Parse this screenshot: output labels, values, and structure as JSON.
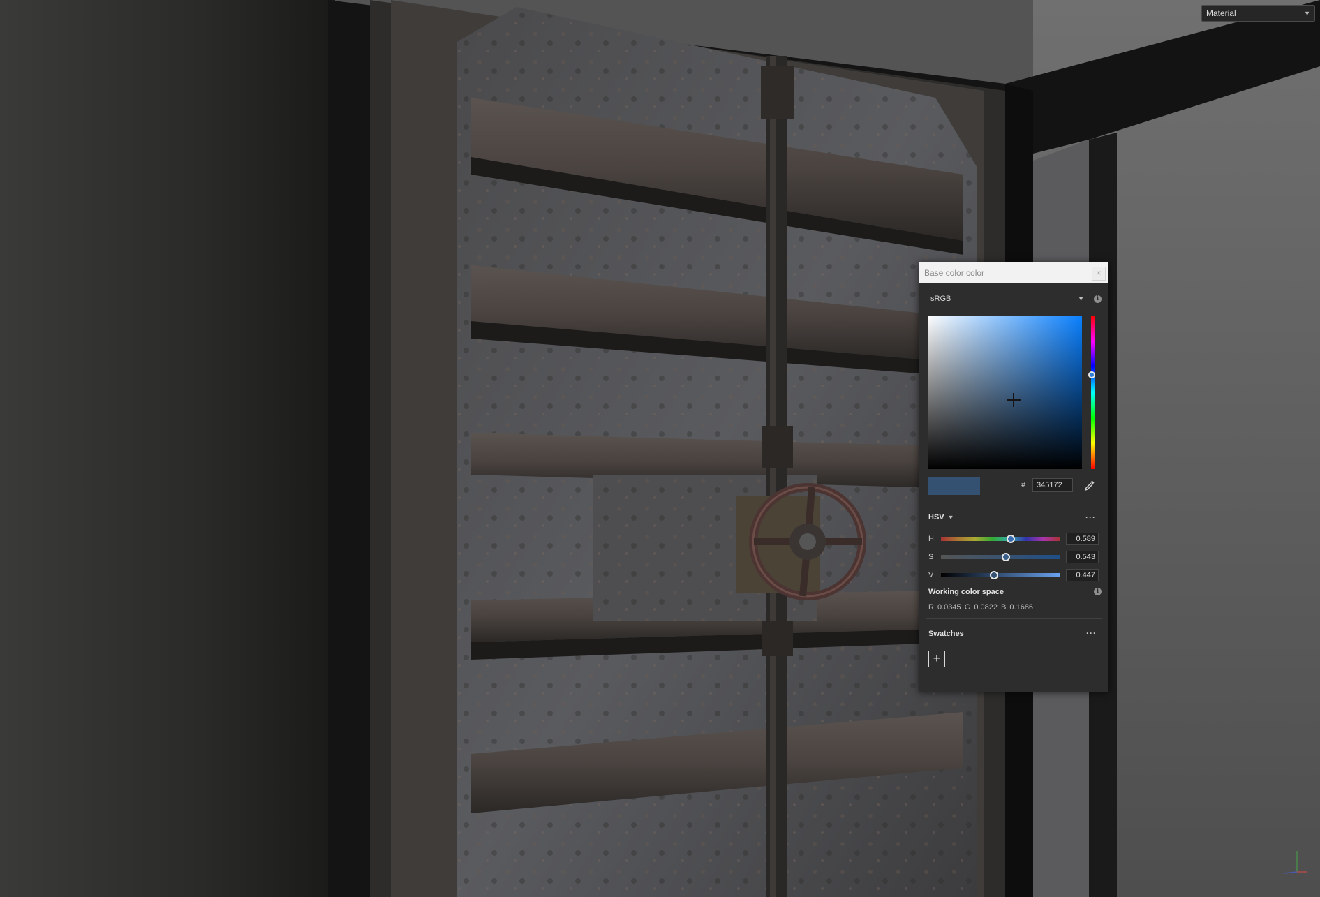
{
  "toolbar": {
    "material_select": {
      "value": "Material",
      "chevron_icon": "chevron-down-icon"
    }
  },
  "color_picker": {
    "title": "Base color color",
    "close_icon": "close-icon",
    "color_space": "sRGB",
    "info_icon": "info-icon",
    "current_color": "#345172",
    "hash_label": "#",
    "hex_value": "345172",
    "eyedropper_icon": "eyedropper-icon",
    "mode": "HSV",
    "more_icon": "more-dots-icon",
    "more_label": "···",
    "sliders": [
      {
        "channel": "H",
        "value": "0.589",
        "fraction": 0.589
      },
      {
        "channel": "S",
        "value": "0.543",
        "fraction": 0.543
      },
      {
        "channel": "V",
        "value": "0.447",
        "fraction": 0.447
      }
    ],
    "working_color_space": {
      "title": "Working color space",
      "values": "R 0.0345   G 0.0822   B 0.1686"
    },
    "swatches": {
      "title": "Swatches",
      "add_label": "+"
    }
  },
  "viewport": {
    "axis_gizmo_icon": "axis-gizmo-icon"
  }
}
